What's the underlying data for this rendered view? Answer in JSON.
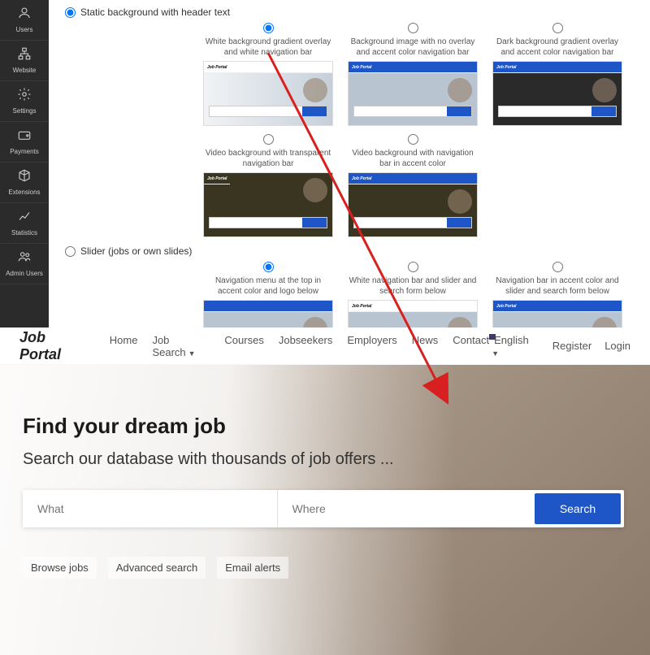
{
  "sidebar": {
    "items": [
      {
        "label": "Users"
      },
      {
        "label": "Website"
      },
      {
        "label": "Settings"
      },
      {
        "label": "Payments"
      },
      {
        "label": "Extensions"
      },
      {
        "label": "Statistics"
      },
      {
        "label": "Admin Users"
      }
    ]
  },
  "admin": {
    "main_radio_static": "Static background with header text",
    "main_radio_slider": "Slider (jobs or own slides)",
    "static_options": [
      "White background gradient overlay and white navigation bar",
      "Background image with no overlay and accent color navigation bar",
      "Dark background gradient overlay and accent color navigation bar",
      "Video background with transparent navigation bar",
      "Video background with navigation bar in accent color"
    ],
    "slider_options": [
      "Navigation menu at the top in accent color and logo below",
      "White navigation bar and slider and search form below",
      "Navigation bar in accent color and slider and search form below"
    ],
    "thumb_brand": "Job Portal"
  },
  "preview": {
    "brand": "Job Portal",
    "nav": [
      "Home",
      "Job Search",
      "Courses",
      "Jobseekers",
      "Employers",
      "News",
      "Contact"
    ],
    "language": "English",
    "register": "Register",
    "login": "Login",
    "hero_title": "Find your dream job",
    "hero_sub": "Search our database with thousands of job offers ...",
    "what_ph": "What",
    "where_ph": "Where",
    "search_btn": "Search",
    "quick_links": [
      "Browse jobs",
      "Advanced search",
      "Email alerts"
    ]
  }
}
